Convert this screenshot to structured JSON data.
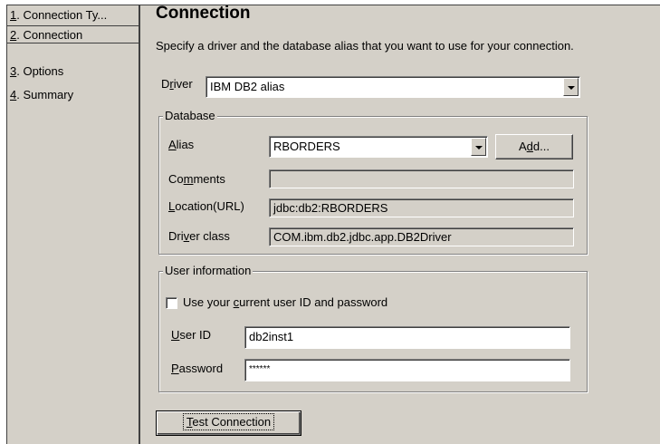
{
  "nav": {
    "items": [
      {
        "num": "1",
        "label": ". Connection Ty..."
      },
      {
        "num": "2",
        "label": ". Connection"
      },
      {
        "num": "3",
        "label": ". Options"
      },
      {
        "num": "4",
        "label": ". Summary"
      }
    ]
  },
  "page": {
    "title": "Connection",
    "description": "Specify a driver and the database alias that you want to use for your connection."
  },
  "driver": {
    "label_pre": "D",
    "label_key": "r",
    "label_post": "iver",
    "value": "IBM DB2 alias"
  },
  "database": {
    "legend": "Database",
    "alias_key": "A",
    "alias_post": "lias",
    "alias_value": "RBORDERS",
    "add_pre": "A",
    "add_key": "d",
    "add_post": "d...",
    "comments_pre": "Co",
    "comments_key": "m",
    "comments_post": "ments",
    "comments_value": "",
    "location_key": "L",
    "location_post": "ocation(URL)",
    "location_value": "jdbc:db2:RBORDERS",
    "driverclass_pre": "Dri",
    "driverclass_key": "v",
    "driverclass_post": "er class",
    "driverclass_value": "COM.ibm.db2.jdbc.app.DB2Driver"
  },
  "user": {
    "legend": "User information",
    "checkbox_pre": "Use your ",
    "checkbox_key": "c",
    "checkbox_post": "urrent user ID and password",
    "userid_key": "U",
    "userid_post": "ser ID",
    "userid_value": "db2inst1",
    "password_key": "P",
    "password_post": "assword",
    "password_value": "******"
  },
  "test": {
    "key": "T",
    "post": "est Connection"
  }
}
